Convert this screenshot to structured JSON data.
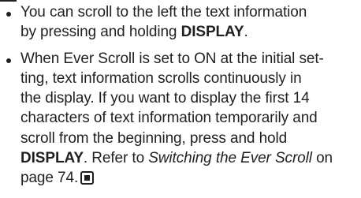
{
  "notes": {
    "item1": {
      "line1": "You can scroll to the left the text information",
      "line2_prefix": "by pressing and holding ",
      "line2_bold": "DISPLAY",
      "line2_suffix": "."
    },
    "item2": {
      "line1": "When Ever Scroll is set to ON at the initial set-",
      "line2": "ting, text information scrolls continuously in",
      "line3": "the display. If you want to display the first 14",
      "line4": "characters of text information temporarily and",
      "line5": "scroll from the beginning, press and hold",
      "line6_bold": "DISPLAY",
      "line6_mid": ". Refer to ",
      "line6_italic": "Switching the Ever Scroll",
      "line6_suffix": " on",
      "line7": "page 74."
    }
  }
}
